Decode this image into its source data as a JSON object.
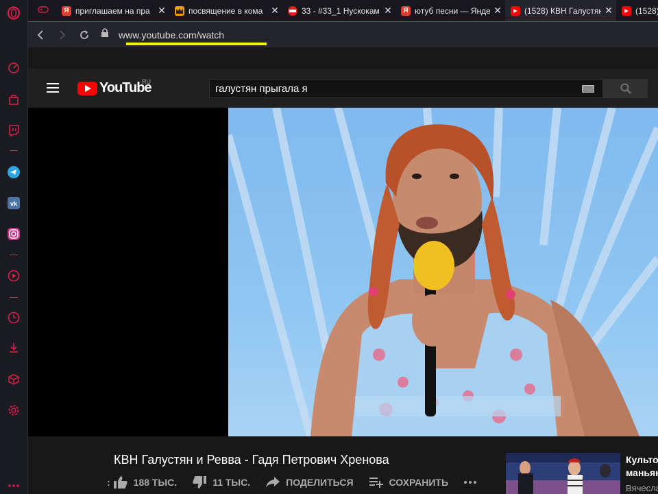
{
  "browser": {
    "tabs": [
      {
        "title": "приглашаем на пра",
        "favicon": "yandex-icon",
        "color": "#e53a2d",
        "glyph": "Я"
      },
      {
        "title": "посвящение в кома",
        "favicon": "crown-icon",
        "color": "#f0a000",
        "glyph": ""
      },
      {
        "title": "33 - #33_1 Нускокам",
        "favicon": "blocked-icon",
        "color": "#e0201c",
        "glyph": ""
      },
      {
        "title": "ютуб песни — Янде",
        "favicon": "yandex-icon",
        "color": "#e53a2d",
        "glyph": "Я"
      },
      {
        "title": "(1528) КВН Галустян",
        "favicon": "youtube-icon",
        "color": "#ff0000",
        "glyph": ""
      },
      {
        "title": "(1528)",
        "favicon": "youtube-icon",
        "color": "#ff0000",
        "glyph": ""
      }
    ],
    "url": "www.youtube.com/watch"
  },
  "youtube": {
    "logo_text": "YouTube",
    "region": "RU",
    "search_query": "галустян прыгала я"
  },
  "video": {
    "title": "КВН Галустян и Ревва - Гадя Петрович Хренова",
    "likes": "188 ТЫС.",
    "dislikes": "11 ТЫС.",
    "share_label": "ПОДЕЛИТЬСЯ",
    "save_label": "СОХРАНИТЬ"
  },
  "recommendation": {
    "title_line1": "Культо",
    "title_line2": "маньяк",
    "channel": "Вячесла"
  },
  "colors": {
    "accent": "#d6204a",
    "youtube_red": "#ff0000"
  }
}
